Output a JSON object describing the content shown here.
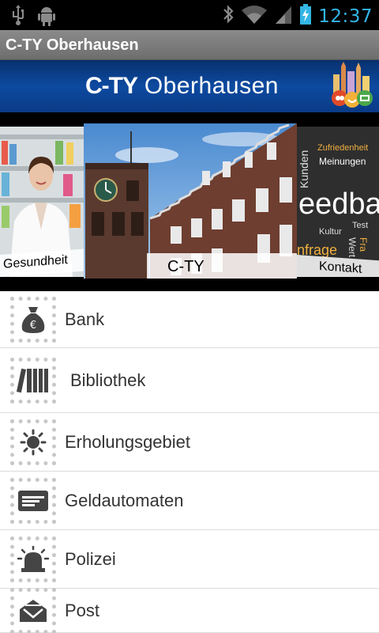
{
  "status_bar": {
    "time": "12:37",
    "left_icons": [
      "usb-icon",
      "android-debug-icon"
    ],
    "right_icons": [
      "bluetooth-icon",
      "wifi-icon",
      "signal-icon",
      "battery-charging-icon"
    ],
    "accent": "#33b5e5"
  },
  "app": {
    "title": "C-TY Oberhausen"
  },
  "banner": {
    "brand_prefix": "C-TY",
    "brand_suffix": "Oberhausen",
    "logo_icon": "city-logo-icon"
  },
  "carousel": {
    "left": "Gesundheit",
    "center": "C-TY",
    "right": "Kontakt",
    "right_words": [
      "Zufriedenheit",
      "Meinungen",
      "Kunden",
      "eedbac",
      "Kultur",
      "Test",
      "Wert",
      "Fra",
      "nfrage"
    ]
  },
  "list": [
    {
      "label": "Bank",
      "icon": "money-bag-icon"
    },
    {
      "label": "Bibliothek",
      "icon": "books-icon"
    },
    {
      "label": "Erholungsgebiet",
      "icon": "sun-icon"
    },
    {
      "label": "Geldautomaten",
      "icon": "atm-card-icon"
    },
    {
      "label": "Polizei",
      "icon": "police-siren-icon"
    },
    {
      "label": "Post",
      "icon": "mail-envelope-icon"
    }
  ]
}
